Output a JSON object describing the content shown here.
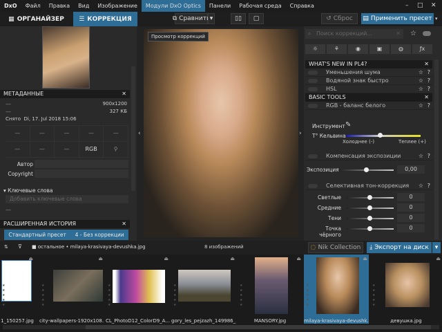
{
  "app": {
    "logo": "DxO"
  },
  "menu": [
    "Файл",
    "Правка",
    "Вид",
    "Изображение",
    "Модули DxO Optics",
    "Панели",
    "Рабочая среда",
    "Справка"
  ],
  "menu_active_index": 4,
  "window_controls": {
    "minimize": "–",
    "maximize": "□",
    "close": "✕"
  },
  "toolbar": {
    "tab_organizer": "ОРГАНАЙЗЕР",
    "tab_correction": "КОРРЕКЦИЯ",
    "compare": "Сравнить",
    "reset": "Сброс",
    "apply_preset": "Применить пресет"
  },
  "colors": {
    "accent": "#2d6d96",
    "bg": "#262626"
  },
  "metadata": {
    "title": "МЕТАДАННЫЕ",
    "dims": "900x1200",
    "size": "327 КБ",
    "dash": "—",
    "shot_label": "Снято",
    "shot_date": "Di, 17. Jul 2018 15:06",
    "grid": [
      "—",
      "—",
      "—",
      "—",
      "—",
      "—",
      "—",
      "—",
      "RGB",
      ""
    ],
    "author_label": "Автор",
    "copyright_label": "Copyright",
    "keywords_label": "Ключевые слова",
    "keywords_placeholder": "Добавить ключевые слова"
  },
  "history": {
    "title": "РАСШИРЕННАЯ ИСТОРИЯ",
    "preset": "Стандартный пресет",
    "state": "4 - Без коррекции"
  },
  "viewer": {
    "tooltip": "Просмотр коррекций"
  },
  "right": {
    "search_placeholder": "Поиск коррекций...",
    "whats_new": {
      "title": "WHAT'S NEW IN PL4?",
      "items": [
        "Уменьшения шума",
        "Водяной знак быстро",
        "HSL"
      ]
    },
    "basic": {
      "title": "BASIC TOOLS",
      "wb": "RGB - баланс белого",
      "tool_label": "Инструмент",
      "kelvin_label": "T° Кельвина",
      "colder": "Холоднее (-)",
      "warmer": "Теплее (+)",
      "kelvin_pos": 0.45,
      "exposure_title": "Компенсация экспозиции",
      "exposure_label": "Экспозиция",
      "exposure_value": "0,00",
      "selective_title": "Селективная тон-коррекция",
      "tones": [
        {
          "label": "Светлые",
          "value": "0"
        },
        {
          "label": "Средние",
          "value": "0"
        },
        {
          "label": "Тени",
          "value": "0"
        },
        {
          "label": "Точка чёрного",
          "value": "0"
        }
      ]
    }
  },
  "filmbar": {
    "path_folder": "остальное",
    "path_file": "milaya-krasivaya-devushka.jpg",
    "count": "8 изображений",
    "nik": "Nik Collection",
    "export": "Экспорт на диск"
  },
  "filmstrip": [
    {
      "name": "1_150257.jpg"
    },
    {
      "name": "city-wallpapers-1920x108..."
    },
    {
      "name": "CL_PhotoD12_ColorD9_A..."
    },
    {
      "name": "gory_les_pejzazh_149986_..."
    },
    {
      "name": "MANSORY.jpg"
    },
    {
      "name": "milaya-krasivaya-devushk...",
      "selected": true
    },
    {
      "name": "девушка.jpg"
    }
  ]
}
